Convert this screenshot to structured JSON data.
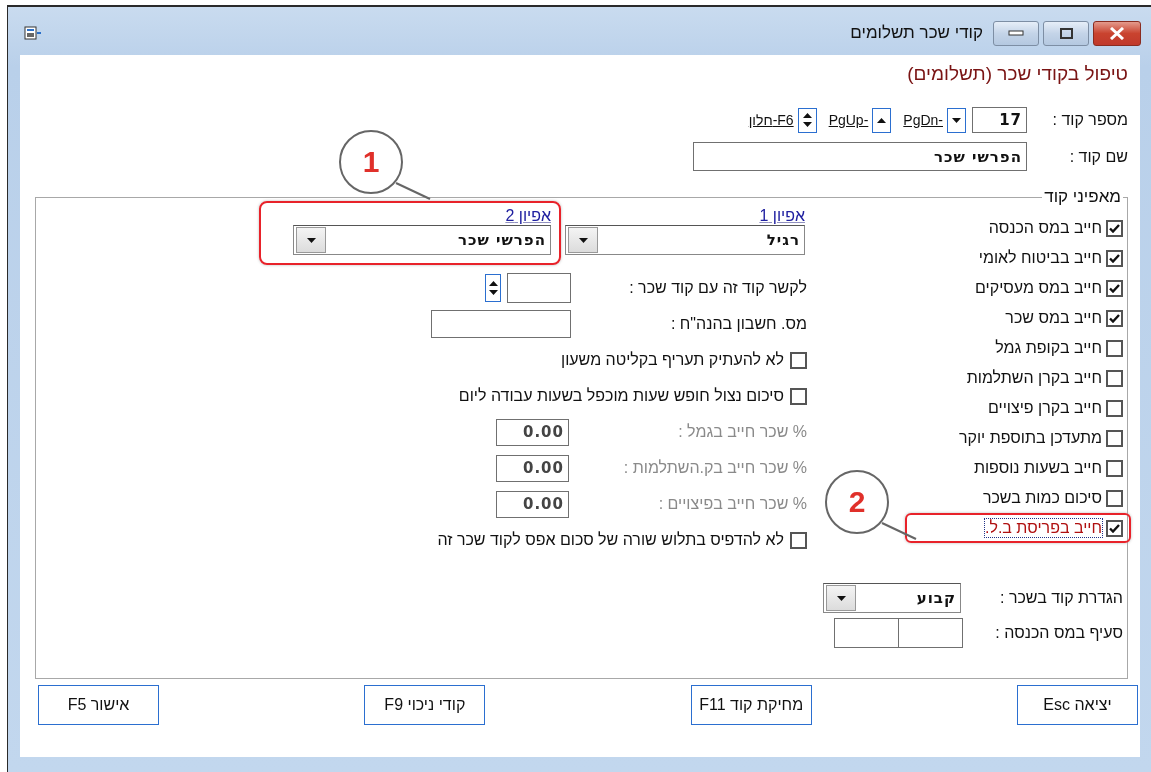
{
  "window": {
    "title": "קודי שכר תשלומים"
  },
  "heading": "טיפול בקודי שכר (תשלומים)",
  "code_number": {
    "label": "מספר קוד :",
    "value": "17"
  },
  "nav_links": [
    {
      "kind": "down",
      "label": "PgDn-"
    },
    {
      "kind": "up",
      "label": "PgUp-"
    },
    {
      "kind": "updown",
      "label": "חלון-F6"
    }
  ],
  "code_name": {
    "label": "שם קוד :",
    "value": "הפרשי שכר"
  },
  "group": {
    "title": "מאפיני קוד"
  },
  "flags": [
    {
      "label": "חייב במס הכנסה",
      "checked": true,
      "highlighted": false,
      "focused": false
    },
    {
      "label": "חייב בביטוח לאומי",
      "checked": true,
      "highlighted": false,
      "focused": false
    },
    {
      "label": "חייב במס מעסיקים",
      "checked": true,
      "highlighted": false,
      "focused": false
    },
    {
      "label": "חייב במס שכר",
      "checked": true,
      "highlighted": false,
      "focused": false
    },
    {
      "label": "חייב בקופת גמל",
      "checked": false,
      "highlighted": false,
      "focused": false
    },
    {
      "label": "חייב בקרן השתלמות",
      "checked": false,
      "highlighted": false,
      "focused": false
    },
    {
      "label": "חייב בקרן פיצויים",
      "checked": false,
      "highlighted": false,
      "focused": false
    },
    {
      "label": "מתעדכן בתוספת יוקר",
      "checked": false,
      "highlighted": false,
      "focused": false
    },
    {
      "label": "חייב בשעות נוספות",
      "checked": false,
      "highlighted": false,
      "focused": false
    },
    {
      "label": "סיכום כמות בשכר",
      "checked": false,
      "highlighted": false,
      "focused": false
    },
    {
      "label": "חייב בפריסת ב.ל.",
      "checked": true,
      "highlighted": true,
      "focused": true
    }
  ],
  "characteristics": [
    {
      "label": "אפיון 1",
      "value": "רגיל",
      "highlighted": false
    },
    {
      "label": "אפיון 2",
      "value": "הפרשי שכר",
      "highlighted": true
    }
  ],
  "rows": [
    {
      "kind": "spin",
      "label": "לקשר קוד זה עם קוד שכר :"
    },
    {
      "kind": "text",
      "label": "מס. חשבון בהנה\"ח :"
    },
    {
      "kind": "checkbox",
      "label": "לא להעתיק תעריף בקליטה משעון",
      "checked": false
    },
    {
      "kind": "checkbox",
      "label": "סיכום נצול חופש שעות מוכפל בשעות עבודה ליום",
      "checked": false
    },
    {
      "kind": "percent",
      "label": "% שכר חייב בגמל :",
      "value": "0.00",
      "disabled": true
    },
    {
      "kind": "percent",
      "label": "% שכר חייב בק.השתלמות :",
      "value": "0.00",
      "disabled": true
    },
    {
      "kind": "percent",
      "label": "% שכר חייב בפיצויים :",
      "value": "0.00",
      "disabled": true
    },
    {
      "kind": "checkbox",
      "label": "לא להדפיס בתלוש שורה של סכום אפס לקוד שכר זה",
      "checked": false
    }
  ],
  "salary_definition": {
    "label": "הגדרת קוד בשכר :",
    "value": "קבוע"
  },
  "income_tax_clause": {
    "label": "סעיף במס הכנסה :"
  },
  "buttons": [
    {
      "label": "יציאה Esc"
    },
    {
      "label": "מחיקת קוד F11"
    },
    {
      "label": "קודי ניכוי F9"
    },
    {
      "label": "אישור F5"
    }
  ],
  "callouts": [
    {
      "number": "1"
    },
    {
      "number": "2"
    }
  ]
}
